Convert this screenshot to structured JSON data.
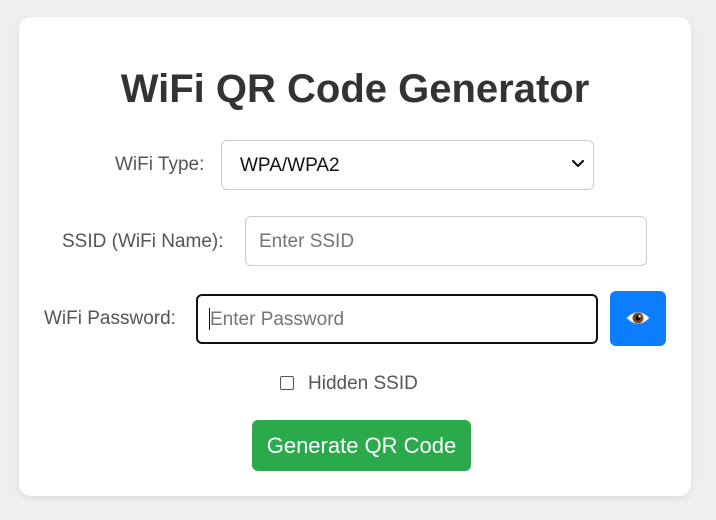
{
  "title": "WiFi QR Code Generator",
  "form": {
    "wifi_type": {
      "label": "WiFi Type:",
      "value": "WPA/WPA2"
    },
    "ssid": {
      "label": "SSID (WiFi Name):",
      "placeholder": "Enter SSID",
      "value": ""
    },
    "password": {
      "label": "WiFi Password:",
      "placeholder": "Enter Password",
      "value": "",
      "toggle_icon": "eye-icon"
    },
    "hidden_ssid": {
      "label": "Hidden SSID",
      "checked": false
    },
    "generate_button": "Generate QR Code"
  },
  "colors": {
    "background": "#efefef",
    "card": "#ffffff",
    "title": "#333333",
    "label": "#555555",
    "eye_button": "#0d7dff",
    "generate_button": "#2aaa4a"
  }
}
